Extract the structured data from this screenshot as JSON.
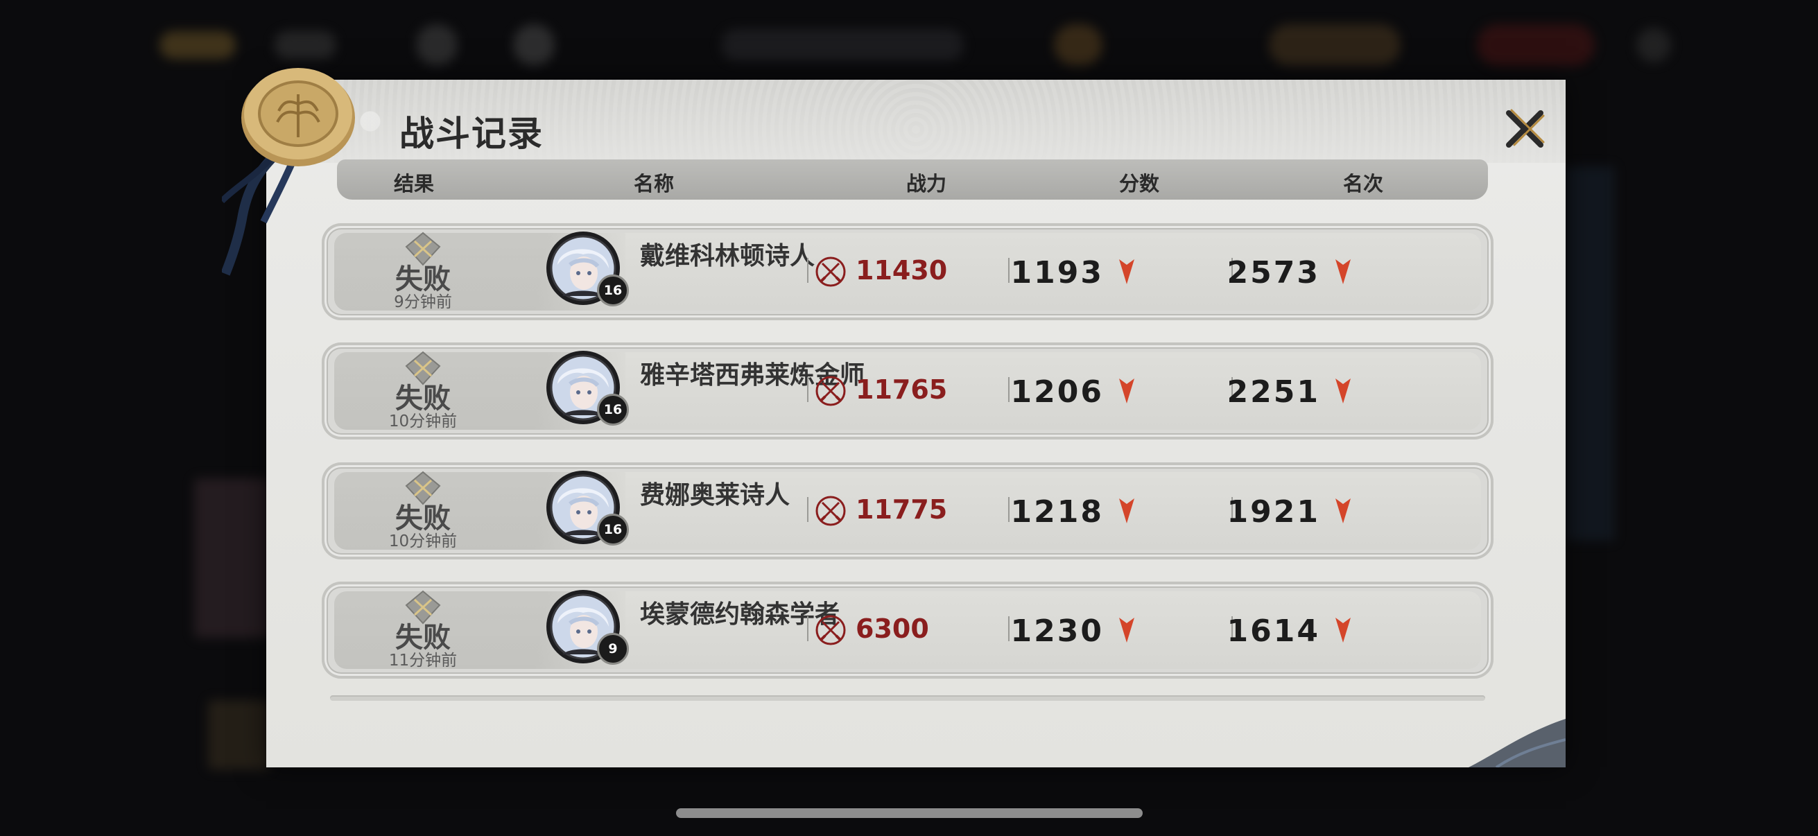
{
  "dialog": {
    "title": "战斗记录",
    "close_icon": "close-x-icon"
  },
  "columns": {
    "result": "结果",
    "name": "名称",
    "power": "战力",
    "score": "分数",
    "rank": "名次"
  },
  "rows": [
    {
      "result": "失败",
      "time": "9分钟前",
      "name": "戴维科林顿诗人",
      "level": "16",
      "power": "11430",
      "score": "1193",
      "rank": "2573"
    },
    {
      "result": "失败",
      "time": "10分钟前",
      "name": "雅辛塔西弗莱炼金师",
      "level": "16",
      "power": "11765",
      "score": "1206",
      "rank": "2251"
    },
    {
      "result": "失败",
      "time": "10分钟前",
      "name": "费娜奥莱诗人",
      "level": "16",
      "power": "11775",
      "score": "1218",
      "rank": "1921"
    },
    {
      "result": "失败",
      "time": "11分钟前",
      "name": "埃蒙德约翰森学者",
      "level": "9",
      "power": "6300",
      "score": "1230",
      "rank": "1614"
    }
  ],
  "colors": {
    "power_text": "#8a1e1e",
    "arrow_red": "#d4452a",
    "seal_gold": "#c9a867"
  },
  "icons": {
    "result": "crossed-swords-shield-icon",
    "power": "crossed-swords-circle-icon",
    "trend": "down-arrow-icon",
    "seal": "wax-seal-icon"
  }
}
